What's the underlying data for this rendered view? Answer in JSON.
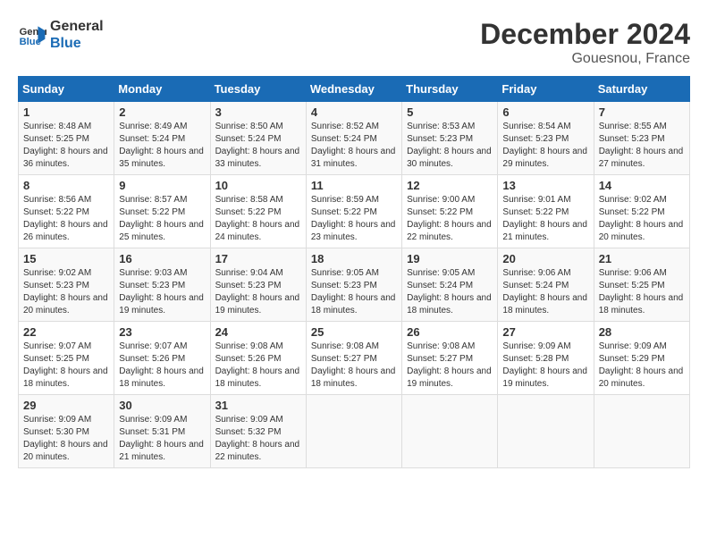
{
  "logo": {
    "line1": "General",
    "line2": "Blue"
  },
  "title": "December 2024",
  "location": "Gouesnou, France",
  "days_of_week": [
    "Sunday",
    "Monday",
    "Tuesday",
    "Wednesday",
    "Thursday",
    "Friday",
    "Saturday"
  ],
  "weeks": [
    [
      {
        "day": "1",
        "sunrise": "Sunrise: 8:48 AM",
        "sunset": "Sunset: 5:25 PM",
        "daylight": "Daylight: 8 hours and 36 minutes."
      },
      {
        "day": "2",
        "sunrise": "Sunrise: 8:49 AM",
        "sunset": "Sunset: 5:24 PM",
        "daylight": "Daylight: 8 hours and 35 minutes."
      },
      {
        "day": "3",
        "sunrise": "Sunrise: 8:50 AM",
        "sunset": "Sunset: 5:24 PM",
        "daylight": "Daylight: 8 hours and 33 minutes."
      },
      {
        "day": "4",
        "sunrise": "Sunrise: 8:52 AM",
        "sunset": "Sunset: 5:24 PM",
        "daylight": "Daylight: 8 hours and 31 minutes."
      },
      {
        "day": "5",
        "sunrise": "Sunrise: 8:53 AM",
        "sunset": "Sunset: 5:23 PM",
        "daylight": "Daylight: 8 hours and 30 minutes."
      },
      {
        "day": "6",
        "sunrise": "Sunrise: 8:54 AM",
        "sunset": "Sunset: 5:23 PM",
        "daylight": "Daylight: 8 hours and 29 minutes."
      },
      {
        "day": "7",
        "sunrise": "Sunrise: 8:55 AM",
        "sunset": "Sunset: 5:23 PM",
        "daylight": "Daylight: 8 hours and 27 minutes."
      }
    ],
    [
      {
        "day": "8",
        "sunrise": "Sunrise: 8:56 AM",
        "sunset": "Sunset: 5:22 PM",
        "daylight": "Daylight: 8 hours and 26 minutes."
      },
      {
        "day": "9",
        "sunrise": "Sunrise: 8:57 AM",
        "sunset": "Sunset: 5:22 PM",
        "daylight": "Daylight: 8 hours and 25 minutes."
      },
      {
        "day": "10",
        "sunrise": "Sunrise: 8:58 AM",
        "sunset": "Sunset: 5:22 PM",
        "daylight": "Daylight: 8 hours and 24 minutes."
      },
      {
        "day": "11",
        "sunrise": "Sunrise: 8:59 AM",
        "sunset": "Sunset: 5:22 PM",
        "daylight": "Daylight: 8 hours and 23 minutes."
      },
      {
        "day": "12",
        "sunrise": "Sunrise: 9:00 AM",
        "sunset": "Sunset: 5:22 PM",
        "daylight": "Daylight: 8 hours and 22 minutes."
      },
      {
        "day": "13",
        "sunrise": "Sunrise: 9:01 AM",
        "sunset": "Sunset: 5:22 PM",
        "daylight": "Daylight: 8 hours and 21 minutes."
      },
      {
        "day": "14",
        "sunrise": "Sunrise: 9:02 AM",
        "sunset": "Sunset: 5:22 PM",
        "daylight": "Daylight: 8 hours and 20 minutes."
      }
    ],
    [
      {
        "day": "15",
        "sunrise": "Sunrise: 9:02 AM",
        "sunset": "Sunset: 5:23 PM",
        "daylight": "Daylight: 8 hours and 20 minutes."
      },
      {
        "day": "16",
        "sunrise": "Sunrise: 9:03 AM",
        "sunset": "Sunset: 5:23 PM",
        "daylight": "Daylight: 8 hours and 19 minutes."
      },
      {
        "day": "17",
        "sunrise": "Sunrise: 9:04 AM",
        "sunset": "Sunset: 5:23 PM",
        "daylight": "Daylight: 8 hours and 19 minutes."
      },
      {
        "day": "18",
        "sunrise": "Sunrise: 9:05 AM",
        "sunset": "Sunset: 5:23 PM",
        "daylight": "Daylight: 8 hours and 18 minutes."
      },
      {
        "day": "19",
        "sunrise": "Sunrise: 9:05 AM",
        "sunset": "Sunset: 5:24 PM",
        "daylight": "Daylight: 8 hours and 18 minutes."
      },
      {
        "day": "20",
        "sunrise": "Sunrise: 9:06 AM",
        "sunset": "Sunset: 5:24 PM",
        "daylight": "Daylight: 8 hours and 18 minutes."
      },
      {
        "day": "21",
        "sunrise": "Sunrise: 9:06 AM",
        "sunset": "Sunset: 5:25 PM",
        "daylight": "Daylight: 8 hours and 18 minutes."
      }
    ],
    [
      {
        "day": "22",
        "sunrise": "Sunrise: 9:07 AM",
        "sunset": "Sunset: 5:25 PM",
        "daylight": "Daylight: 8 hours and 18 minutes."
      },
      {
        "day": "23",
        "sunrise": "Sunrise: 9:07 AM",
        "sunset": "Sunset: 5:26 PM",
        "daylight": "Daylight: 8 hours and 18 minutes."
      },
      {
        "day": "24",
        "sunrise": "Sunrise: 9:08 AM",
        "sunset": "Sunset: 5:26 PM",
        "daylight": "Daylight: 8 hours and 18 minutes."
      },
      {
        "day": "25",
        "sunrise": "Sunrise: 9:08 AM",
        "sunset": "Sunset: 5:27 PM",
        "daylight": "Daylight: 8 hours and 18 minutes."
      },
      {
        "day": "26",
        "sunrise": "Sunrise: 9:08 AM",
        "sunset": "Sunset: 5:27 PM",
        "daylight": "Daylight: 8 hours and 19 minutes."
      },
      {
        "day": "27",
        "sunrise": "Sunrise: 9:09 AM",
        "sunset": "Sunset: 5:28 PM",
        "daylight": "Daylight: 8 hours and 19 minutes."
      },
      {
        "day": "28",
        "sunrise": "Sunrise: 9:09 AM",
        "sunset": "Sunset: 5:29 PM",
        "daylight": "Daylight: 8 hours and 20 minutes."
      }
    ],
    [
      {
        "day": "29",
        "sunrise": "Sunrise: 9:09 AM",
        "sunset": "Sunset: 5:30 PM",
        "daylight": "Daylight: 8 hours and 20 minutes."
      },
      {
        "day": "30",
        "sunrise": "Sunrise: 9:09 AM",
        "sunset": "Sunset: 5:31 PM",
        "daylight": "Daylight: 8 hours and 21 minutes."
      },
      {
        "day": "31",
        "sunrise": "Sunrise: 9:09 AM",
        "sunset": "Sunset: 5:32 PM",
        "daylight": "Daylight: 8 hours and 22 minutes."
      },
      null,
      null,
      null,
      null
    ]
  ]
}
